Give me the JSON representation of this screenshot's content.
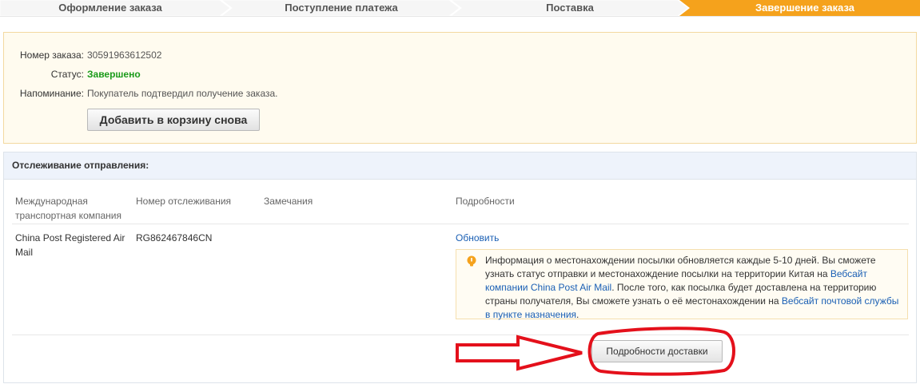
{
  "steps": [
    {
      "label": "Оформление заказа",
      "active": false
    },
    {
      "label": "Поступление платежа",
      "active": false
    },
    {
      "label": "Поставка",
      "active": false
    },
    {
      "label": "Завершение заказа",
      "active": true
    }
  ],
  "colors": {
    "step_bg": "#f6f6f6",
    "step_active": "#f5a21c",
    "accent_green": "#1a9b1a",
    "link": "#1a5fb4",
    "annotation_red": "#e4101b"
  },
  "order": {
    "number_label": "Номер заказа:",
    "number_value": "30591963612502",
    "status_label": "Статус:",
    "status_value": "Завершено",
    "reminder_label": "Напоминание:",
    "reminder_value": "Покупатель подтвердил получение заказа.",
    "reorder_button": "Добавить в корзину снова"
  },
  "tracking": {
    "title": "Отслеживание отправления:",
    "columns": {
      "carrier_line1": "Международная",
      "carrier_line2": "транспортная компания",
      "tracking_number": "Номер отслеживания",
      "remarks": "Замечания",
      "details": "Подробности"
    },
    "row": {
      "carrier_line1": "China Post Registered Air",
      "carrier_line2": "Mail",
      "tracking_number": "RG862467846CN",
      "remarks": "",
      "refresh_link": "Обновить"
    },
    "info": {
      "icon": "lightbulb-icon",
      "text_part1": "Информация о местонахождении посылки обновляется каждые 5-10 дней. Вы сможете узнать статус отправки и местонахождение посылки на территории Китая на ",
      "link1": "Вебсайт компании China Post Air Mail",
      "text_part2": ". После того, как посылка будет доставлена на территорию страны получателя, Вы сможете узнать о её местонахождении на ",
      "link2": "Вебсайт почтовой службы в пункте назначения",
      "text_part3": "."
    },
    "details_button": "Подробности доставки"
  }
}
